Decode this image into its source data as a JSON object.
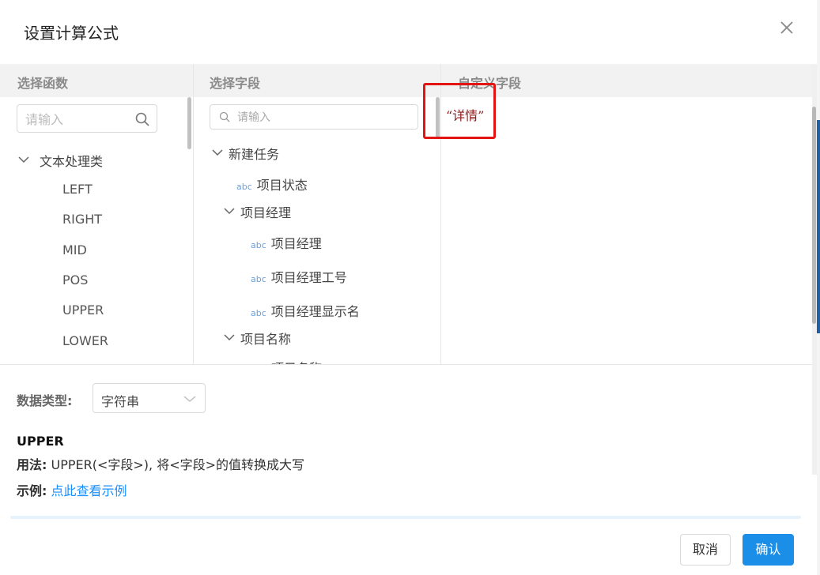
{
  "dialog": {
    "title": "设置计算公式"
  },
  "columns": {
    "functions_header": "选择函数",
    "fields_header": "选择字段",
    "custom_header": "自定义字段"
  },
  "function_search": {
    "placeholder": "请输入"
  },
  "field_search": {
    "placeholder": "请输入"
  },
  "function_group": {
    "label": "文本处理类",
    "items": [
      "LEFT",
      "RIGHT",
      "MID",
      "POS",
      "UPPER",
      "LOWER"
    ]
  },
  "field_tree": {
    "root_label": "新建任务",
    "root_child_prefix": "abc",
    "root_child_label": "项目状态",
    "group1_label": "项目经理",
    "group1_items": [
      {
        "prefix": "abc",
        "label": "项目经理"
      },
      {
        "prefix": "abc",
        "label": "项目经理工号"
      },
      {
        "prefix": "abc",
        "label": "项目经理显示名"
      }
    ],
    "group2_label": "项目名称",
    "group2_first_item": "项目名称"
  },
  "custom_field": {
    "value": "“详情”"
  },
  "data_type": {
    "label": "数据类型:",
    "selected": "字符串"
  },
  "function_help": {
    "name": "UPPER",
    "usage_label": "用法:",
    "usage_text": "UPPER(<字段>), 将<字段>的值转换成大写",
    "example_label": "示例:",
    "example_link": "点此查看示例"
  },
  "buttons": {
    "cancel": "取消",
    "confirm": "确认"
  },
  "colors": {
    "accent": "#1b8ee8",
    "link": "#1890ff",
    "highlight_box": "#e31414",
    "custom_text": "#8b1a1a"
  },
  "icons": {
    "close": "close-icon",
    "search": "search-icon",
    "chevron": "chevron-down-icon"
  }
}
